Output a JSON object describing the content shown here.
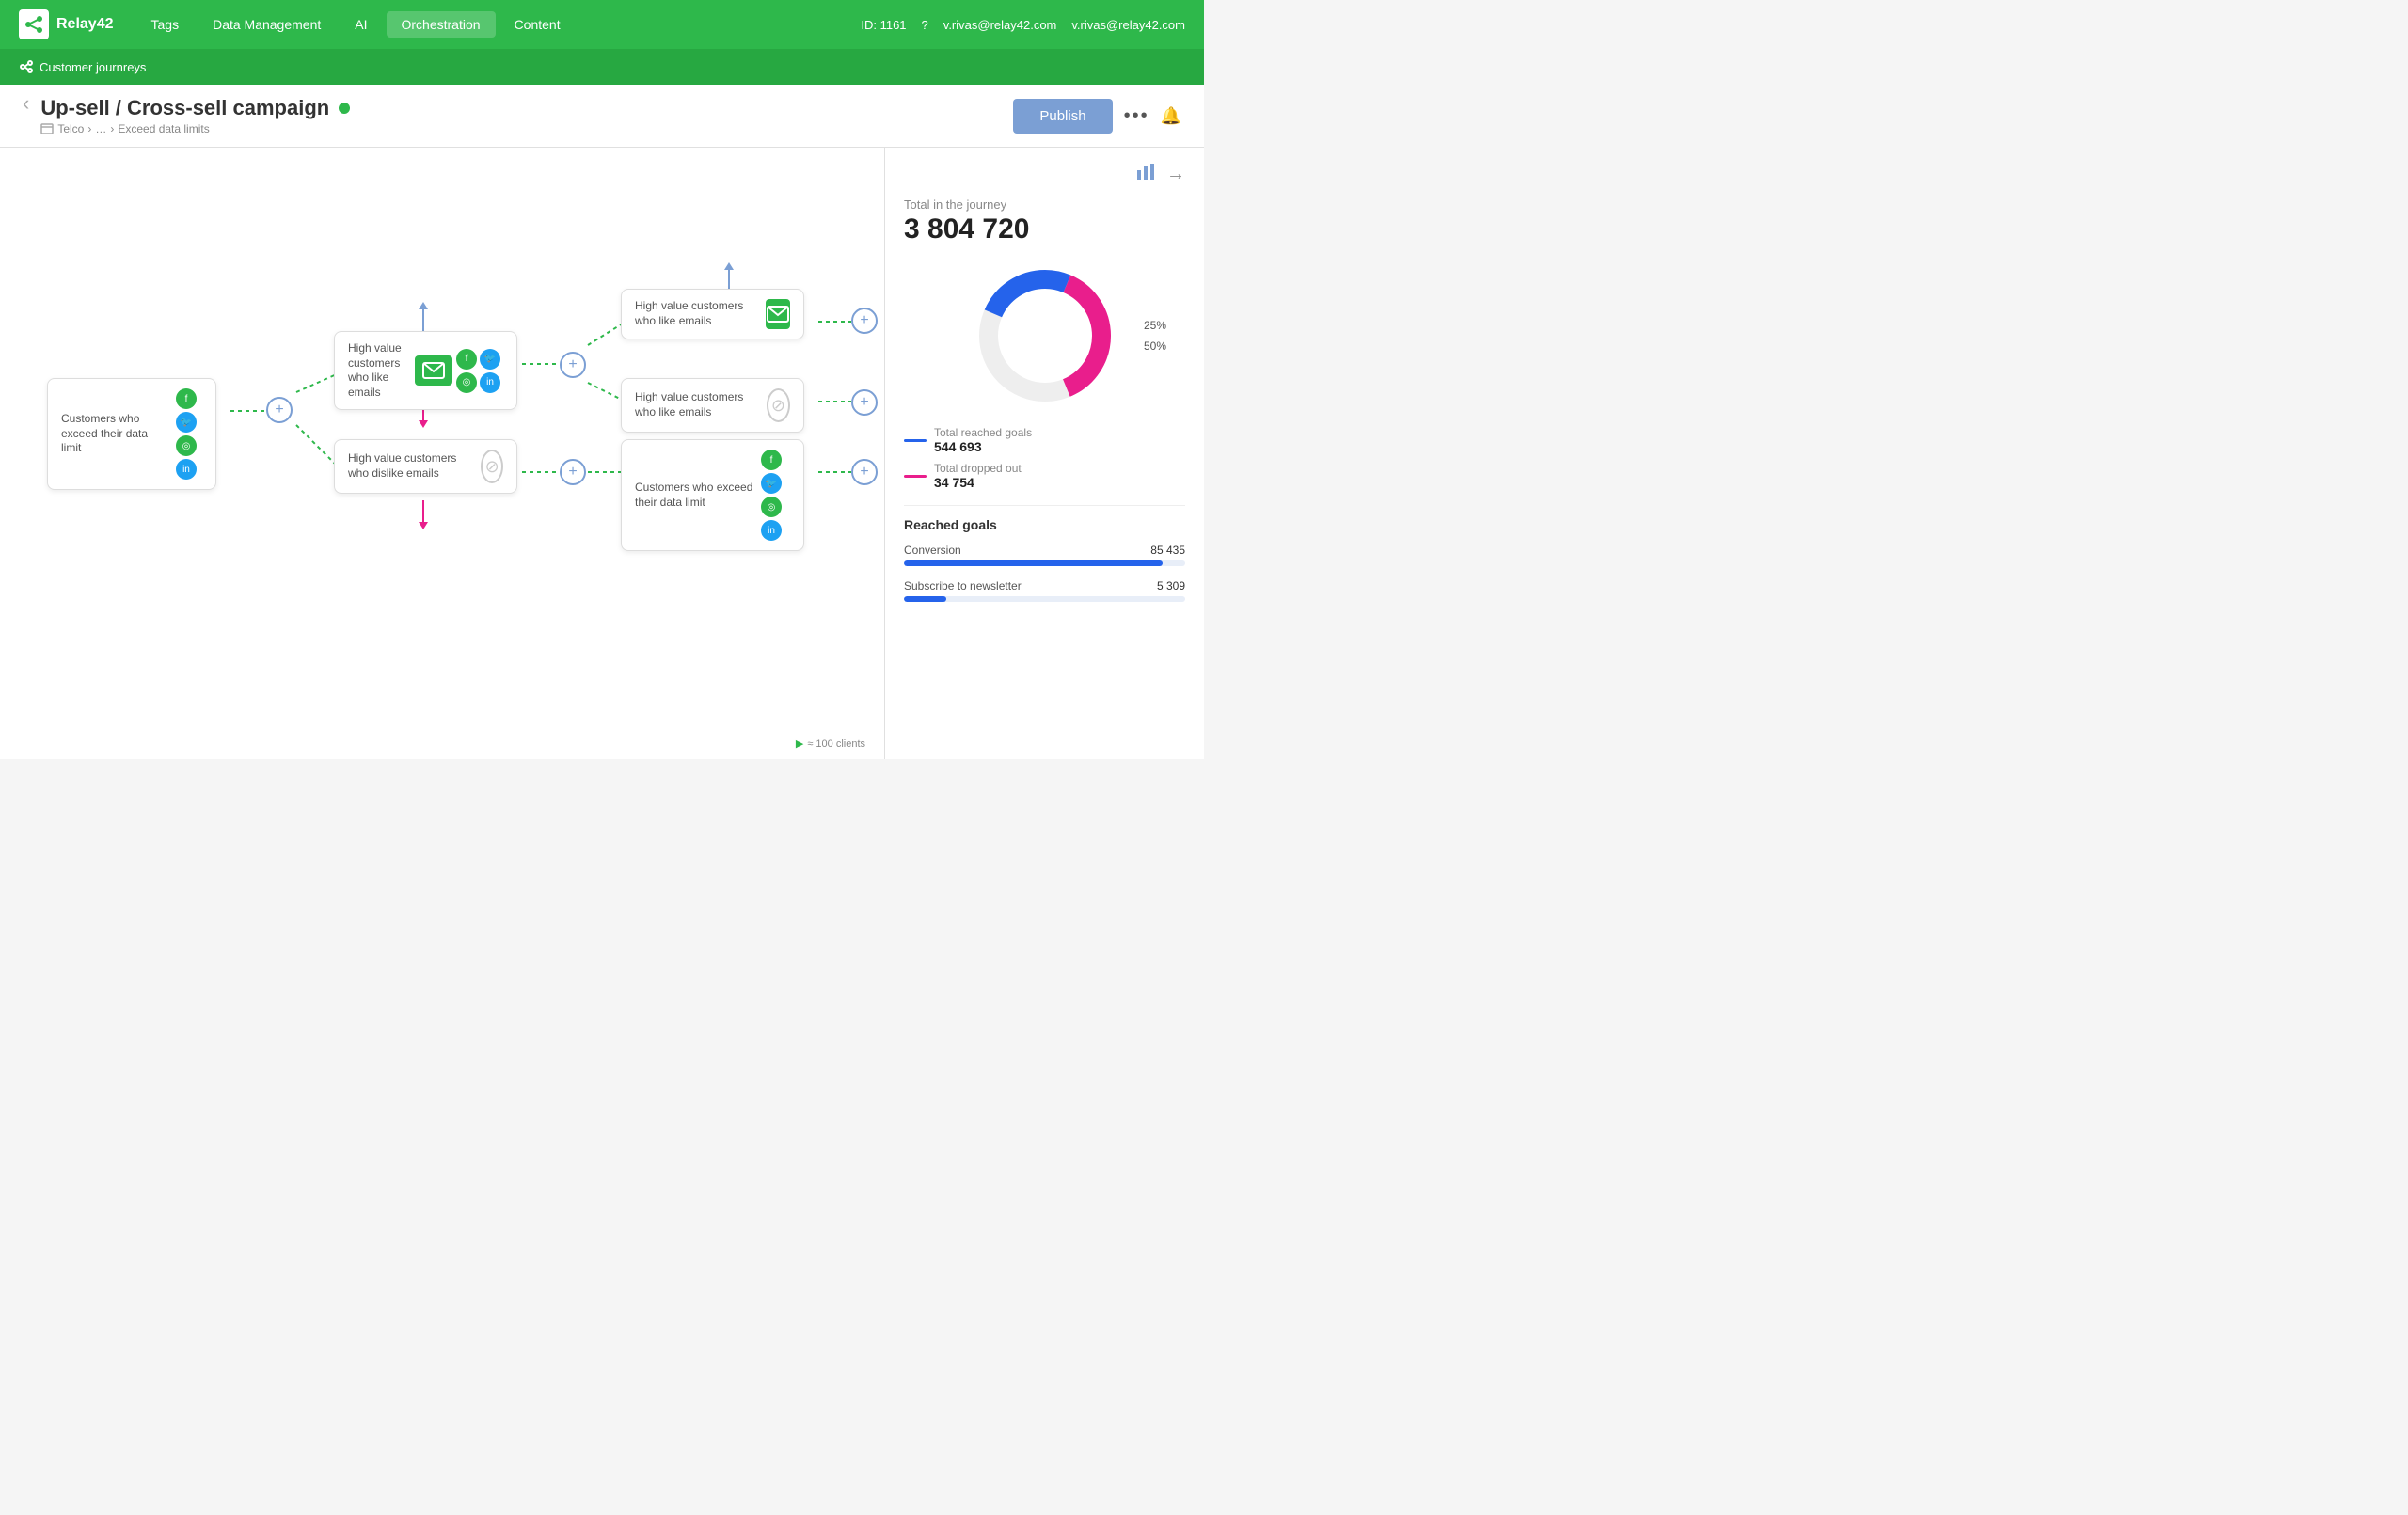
{
  "app": {
    "name": "Relay42",
    "version": "ID: 1161",
    "user": "v.rivas@relay42.com"
  },
  "nav": {
    "items": [
      "Tags",
      "Data Management",
      "AI",
      "Orchestration",
      "Content"
    ],
    "active": "Orchestration",
    "subnav": "Customer journreys"
  },
  "page": {
    "title": "Up-sell / Cross-sell campaign",
    "status_dot": "active",
    "breadcrumb": [
      "Telco",
      "…",
      "Exceed data limits"
    ],
    "publish_label": "Publish"
  },
  "actions": {
    "more_label": "•••",
    "bell_label": "🔔"
  },
  "stats": {
    "total_label": "Total in the journey",
    "total_number": "3 804 720",
    "donut_label_25": "25%",
    "donut_label_50": "50%",
    "legend": [
      {
        "color": "blue",
        "label": "Total reached goals",
        "value": "544 693"
      },
      {
        "color": "pink",
        "label": "Total dropped out",
        "value": "34 754"
      }
    ],
    "reached_goals_title": "Reached goals",
    "goals": [
      {
        "name": "Conversion",
        "value": "85 435",
        "pct": 92
      },
      {
        "name": "Subscribe to newsletter",
        "value": "5 309",
        "pct": 15
      }
    ]
  },
  "nodes": {
    "node1": {
      "text": "Customers who exceed their data limit",
      "type": "icons"
    },
    "node2": {
      "text": "High value customers who like emails",
      "type": "email+icons"
    },
    "node3": {
      "text": "High value customers who dislike emails",
      "type": "null"
    },
    "node4": {
      "text": "High value customers who like emails",
      "type": "email"
    },
    "node5": {
      "text": "High value customers who like emails",
      "type": "null"
    },
    "node6": {
      "text": "Customers who exceed their data limit",
      "type": "icons"
    }
  },
  "footer": {
    "legend": "≈ 100 clients"
  }
}
